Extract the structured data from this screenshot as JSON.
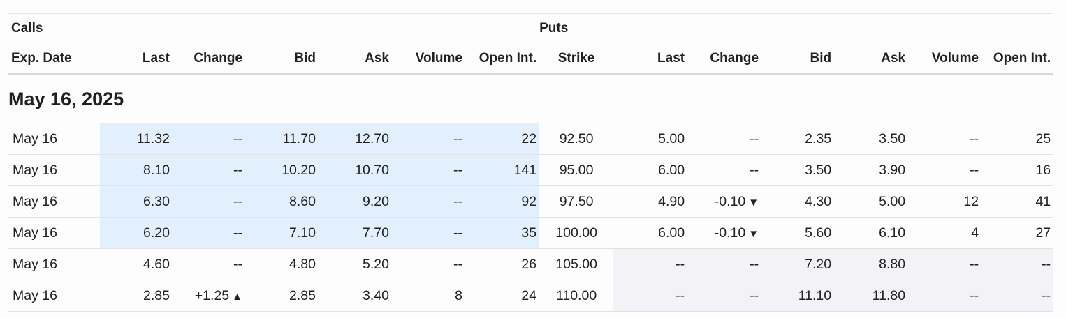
{
  "sections": {
    "calls": "Calls",
    "puts": "Puts"
  },
  "headers": {
    "exp_date": "Exp. Date",
    "calls": [
      "Last",
      "Change",
      "Bid",
      "Ask",
      "Volume",
      "Open Int."
    ],
    "strike": "Strike",
    "puts": [
      "Last",
      "Change",
      "Bid",
      "Ask",
      "Volume",
      "Open Int."
    ]
  },
  "expiration_group": "May 16, 2025",
  "colors": {
    "itm_call_bg": "#e2f0fd",
    "otm_put_bg": "#f3f3f7",
    "strike_text": "#1a7f8e",
    "negative": "#d0202a",
    "positive": "#1b7a33"
  },
  "rows": [
    {
      "exp": "May 16",
      "call": {
        "last": "11.32",
        "change": "--",
        "bid": "11.70",
        "ask": "12.70",
        "volume": "--",
        "open_int": "22"
      },
      "strike": "92.50",
      "put": {
        "last": "5.00",
        "change": "--",
        "bid": "2.35",
        "ask": "3.50",
        "volume": "--",
        "open_int": "25"
      }
    },
    {
      "exp": "May 16",
      "call": {
        "last": "8.10",
        "change": "--",
        "bid": "10.20",
        "ask": "10.70",
        "volume": "--",
        "open_int": "141"
      },
      "strike": "95.00",
      "put": {
        "last": "6.00",
        "change": "--",
        "bid": "3.50",
        "ask": "3.90",
        "volume": "--",
        "open_int": "16"
      }
    },
    {
      "exp": "May 16",
      "call": {
        "last": "6.30",
        "change": "--",
        "bid": "8.60",
        "ask": "9.20",
        "volume": "--",
        "open_int": "92"
      },
      "strike": "97.50",
      "put": {
        "last": "4.90",
        "change": "-0.10",
        "change_dir": "down",
        "bid": "4.30",
        "ask": "5.00",
        "volume": "12",
        "open_int": "41"
      }
    },
    {
      "exp": "May 16",
      "call": {
        "last": "6.20",
        "change": "--",
        "bid": "7.10",
        "ask": "7.70",
        "volume": "--",
        "open_int": "35"
      },
      "strike": "100.00",
      "put": {
        "last": "6.00",
        "change": "-0.10",
        "change_dir": "down",
        "bid": "5.60",
        "ask": "6.10",
        "volume": "4",
        "open_int": "27"
      }
    },
    {
      "exp": "May 16",
      "call": {
        "last": "4.60",
        "change": "--",
        "bid": "4.80",
        "ask": "5.20",
        "volume": "--",
        "open_int": "26"
      },
      "strike": "105.00",
      "put": {
        "last": "--",
        "change": "--",
        "bid": "7.20",
        "ask": "8.80",
        "volume": "--",
        "open_int": "--"
      }
    },
    {
      "exp": "May 16",
      "call": {
        "last": "2.85",
        "change": "+1.25",
        "change_dir": "up",
        "bid": "2.85",
        "ask": "3.40",
        "volume": "8",
        "open_int": "24"
      },
      "strike": "110.00",
      "put": {
        "last": "--",
        "change": "--",
        "bid": "11.10",
        "ask": "11.80",
        "volume": "--",
        "open_int": "--"
      }
    }
  ]
}
